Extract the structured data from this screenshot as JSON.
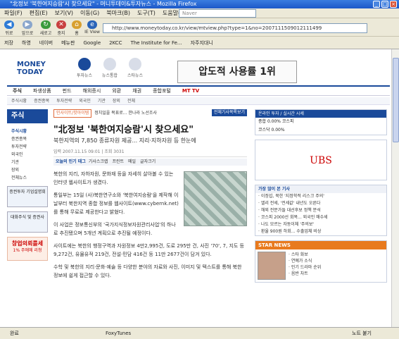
{
  "window": {
    "title": "\"北정보 '북한여지승람'시 찾으세요\" - 머니투데이&투자뉴스 - Mozilla Firefox",
    "controls": [
      "_",
      "□",
      "×"
    ]
  },
  "menu": [
    "파일(F)",
    "편집(E)",
    "보기(V)",
    "이동(G)",
    "북마크(B)",
    "도구(T)",
    "도움말(H)"
  ],
  "search": {
    "placeholder": "Naver"
  },
  "toolbar": {
    "buttons": [
      "뒤로",
      "앞으로",
      "새로고침",
      "중지",
      "홈",
      "IE View",
      "Tab"
    ],
    "url": "http://www.moneytoday.co.kr/view/mtview.php?type=1&no=2007111509012111499"
  },
  "bookmarks": [
    "저장",
    "하영",
    "네이버",
    "메뉴판",
    "Google",
    "2KCC",
    "The Institute for Fe...",
    "자주지대니"
  ],
  "site": {
    "logo_top": "MONEY",
    "logo_bottom": "TODAY",
    "sections": [
      "투자뉴스",
      "뉴스통합",
      "스타뉴스"
    ],
    "ad": "압도적 사용률 1위"
  },
  "main_nav": [
    "주식",
    "파생상품",
    "펀드",
    "해외증시",
    "외환",
    "채권",
    "종합포털",
    "MT TV"
  ],
  "sub_nav": [
    "주식시황",
    "증권종목",
    "투자전략",
    "외국인",
    "기관",
    "장외",
    "전체"
  ],
  "left": {
    "section_title": "주식",
    "items": [
      "주식시황",
      "증권종목",
      "투자전략",
      "외국인",
      "기관",
      "장외",
      "전체뉴스"
    ],
    "promo1": "증권투자 기업설명회",
    "promo2": "대화주식 및 증권사",
    "promo3": "창업의뢰를세",
    "promo3_sub": "1% 주에메 리청"
  },
  "article": {
    "tag": "인사이트/핫아이템",
    "crumb": "정치일을 목표로... 한나라 노선조사",
    "btn_list": "전체기사목록보기",
    "headline": "\"北정보 '북한여지승람'시 찾으세요\"",
    "subhead": "북한지역의 7,850 종류자원 제공... 지리·지하자원 등 한눈에",
    "meta": "입력 2007.11.15 09:01 | 조회 3031",
    "tools_label": "오늘의 인기 태그",
    "tools": [
      "기사스크랩",
      "프린트",
      "메일",
      "글자크기"
    ],
    "paragraphs": [
      "북한의 지리, 자하자원, 문화재 등을 자세히 살아볼 수 있는 인터넷 웹사이트가 생겼다.",
      "통일부는 15일 (사)북한연구소와 '북한여지승람'을 제작해 이날부터 북한지역 종합 정보를 웹사이트(www.cybernk.net)를 통해 무료로 제공한다고 밝혔다.",
      "이 사업은 정보통신부의 '국가지식정보자원관리사업'의 하나로 추진됐으며 5개년 계획으로 추진될 예정이다.",
      "사이트에는 북한의 행정구역과 자원정보 4만2,995건, 도로 295만 건, 사진 '70', 7, 지도 등 9,272건, 유물유적 219건, 전설·민담 416건 등 11만 2677건이 담겨 있다.",
      "수학 및 북한의 지리·문화·예술 등 다양한 분야의 자료와 사진, 이미지 및 텍스트를 통해 북한 정보에 쉽게 접근할 수 있다."
    ]
  },
  "right": {
    "box1_title": "온라인 투자 / 실시간 시세",
    "box1_rows": [
      "종합  0.00% 코스피",
      "코스닥 0.00%"
    ],
    "ubs": "UBS",
    "news_title": "가장 많이 본 기사",
    "news_rows": [
      "· 이정섭, 북한 '지정학적 리스크 주의'",
      "· 엘리 전세, '전세값' 내년도 오른다",
      "· 해외 전문가들 대선후보 정책 분석",
      "· 코스피 2000선 회복... 외국인 매수세",
      "· 나도 모르는 자동이체 '주의보'",
      "· 환율 900원 하회... 수출업체 비상"
    ],
    "star_title": "STAR NEWS",
    "star_rows": [
      "· 스타 화보",
      "· 연예가 소식",
      "· 인기 드라마 순위",
      "· 음반 차트"
    ]
  },
  "status": {
    "left": "완료",
    "center": "FoxyTunes",
    "right": "노트 붙기"
  }
}
